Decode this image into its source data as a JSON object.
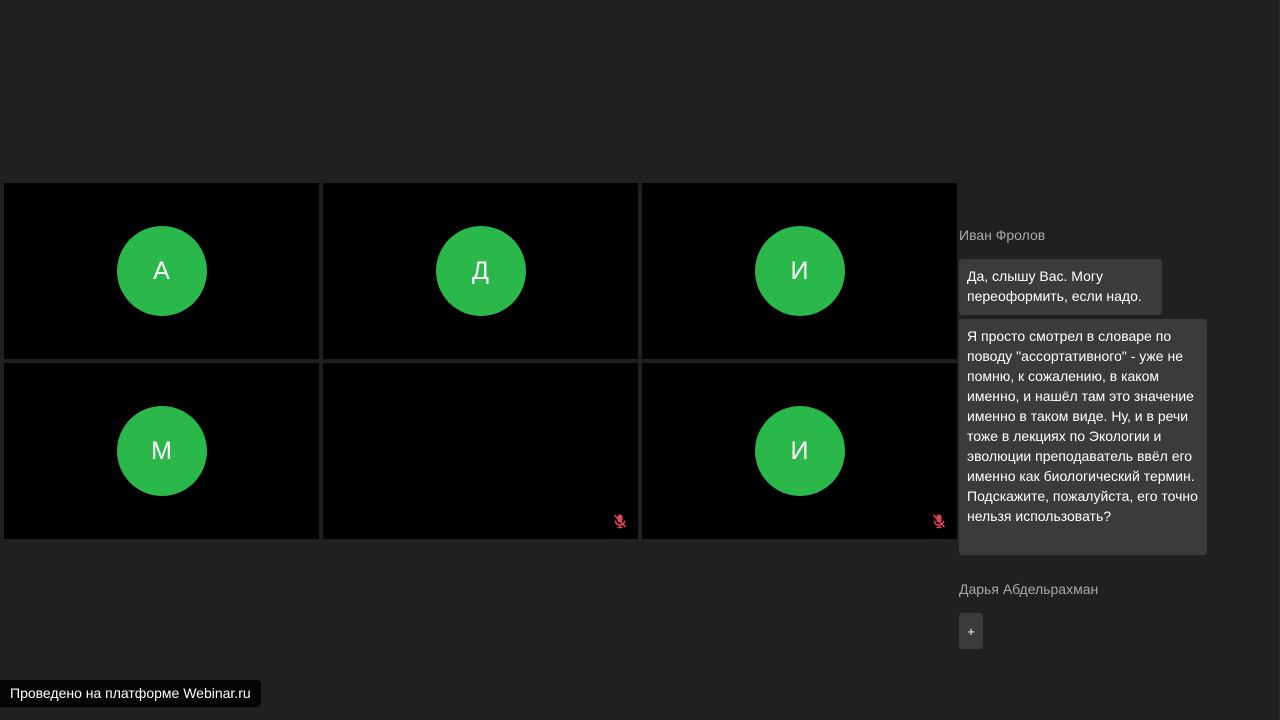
{
  "participants": [
    {
      "initial": "А",
      "has_avatar": true,
      "muted": false
    },
    {
      "initial": "Д",
      "has_avatar": true,
      "muted": false
    },
    {
      "initial": "И",
      "has_avatar": true,
      "muted": false
    },
    {
      "initial": "М",
      "has_avatar": true,
      "muted": false
    },
    {
      "initial": "",
      "has_avatar": false,
      "muted": true
    },
    {
      "initial": "И",
      "has_avatar": true,
      "muted": true
    }
  ],
  "chat": {
    "group1": {
      "author": "Иван Фролов",
      "messages": [
        "Да, слышу Вас. Могу переоформить, если надо.",
        "Я просто смотрел в словаре по поводу \"ассортативного\" - уже не помню, к сожалению, в каком именно, и нашёл там это значение именно в таком виде. Ну, и в речи тоже в лекциях по Экологии и эволюции преподаватель ввёл его именно как биологический термин. Подскажите, пожалуйста, его точно нельзя использовать?"
      ]
    },
    "group2": {
      "author": "Дарья Абдельрахман",
      "button_label": "+"
    }
  },
  "footer": {
    "text": "Проведено на платформе Webinar.ru"
  },
  "colors": {
    "background": "#1f2020",
    "avatar": "#2bb84b",
    "bubble": "#3b3b3b",
    "mute_icon": "#e0455a"
  }
}
